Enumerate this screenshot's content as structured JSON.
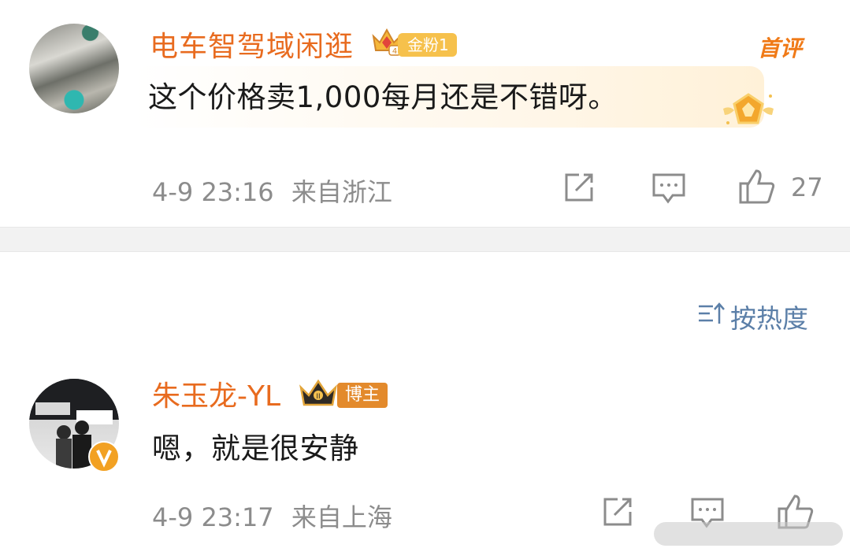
{
  "comments": [
    {
      "username": "电车智驾域闲逛",
      "fan_badge": "金粉1",
      "crown_level": "4",
      "first_comment_label": "首评",
      "text": "这个价格卖1,000每月还是不错呀。",
      "timestamp": "4-9 23:16",
      "location": "来自浙江",
      "like_count": "27"
    },
    {
      "username": "朱玉龙-YL",
      "role_badge": "博主",
      "crown_level": "II",
      "text": "嗯，就是很安静",
      "timestamp": "4-9 23:17",
      "location": "来自上海",
      "like_count": ""
    }
  ],
  "sort": {
    "label": "按热度"
  },
  "icons": {
    "share": "share-icon",
    "comment": "comment-icon",
    "like": "thumbs-up-icon",
    "sort": "sort-icon"
  },
  "colors": {
    "username": "#e86b1f",
    "meta_gray": "#8c8c8c",
    "sort_blue": "#5b7fa8",
    "fan_badge": "#f6c14c",
    "blogger_badge": "#e38a2c"
  }
}
